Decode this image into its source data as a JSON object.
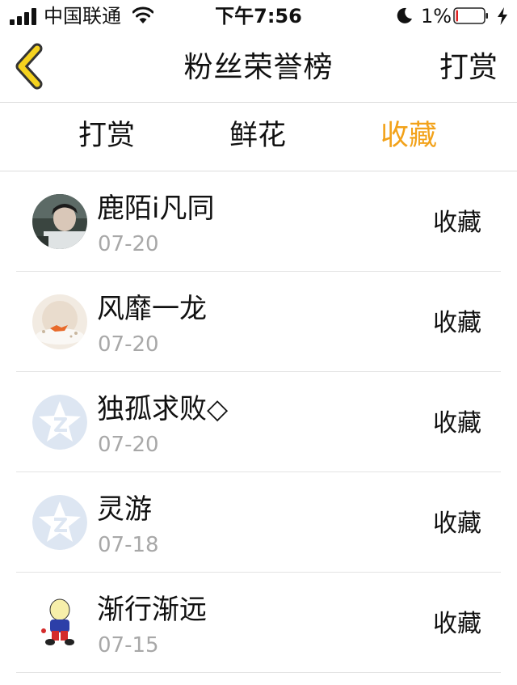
{
  "status_bar": {
    "carrier": "中国联通",
    "time": "下午7:56",
    "battery": "1%"
  },
  "nav": {
    "title": "粉丝荣誉榜",
    "right_label": "打赏"
  },
  "tabs": [
    {
      "label": "打赏",
      "active": false
    },
    {
      "label": "鲜花",
      "active": false
    },
    {
      "label": "收藏",
      "active": true
    }
  ],
  "colors": {
    "accent": "#f2a21a",
    "back_icon": "#f5d21f"
  },
  "list": [
    {
      "name": "鹿陌i凡同",
      "date": "07-20",
      "action": "收藏",
      "avatar": "photo-avatar"
    },
    {
      "name": "风靡一龙",
      "date": "07-20",
      "action": "收藏",
      "avatar": "winter-fox-avatar"
    },
    {
      "name": "独孤求败◇",
      "date": "07-20",
      "action": "收藏",
      "avatar": "default-star-avatar"
    },
    {
      "name": "灵游",
      "date": "07-18",
      "action": "收藏",
      "avatar": "default-star-avatar"
    },
    {
      "name": "渐行渐远",
      "date": "07-15",
      "action": "收藏",
      "avatar": "cartoon-avatar"
    }
  ]
}
